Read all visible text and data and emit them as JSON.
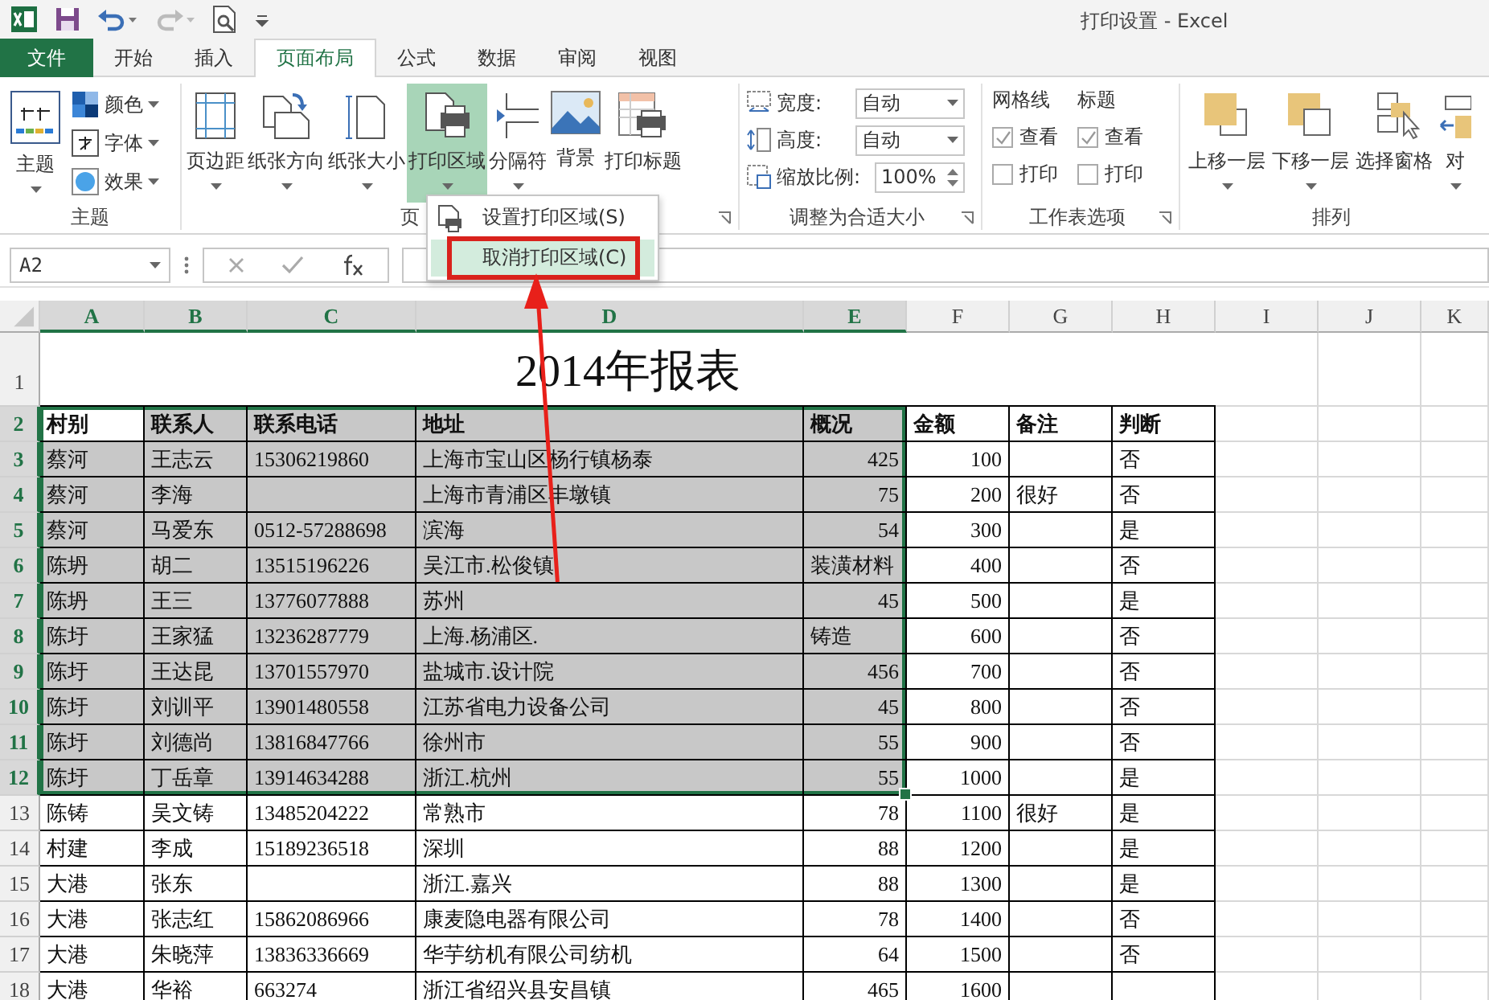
{
  "window": {
    "title": "打印设置 - Excel"
  },
  "tabs": [
    {
      "label": "文件",
      "kind": "file",
      "selected": false
    },
    {
      "label": "开始",
      "kind": "tab",
      "selected": false
    },
    {
      "label": "插入",
      "kind": "tab",
      "selected": false
    },
    {
      "label": "页面布局",
      "kind": "tab",
      "selected": true
    },
    {
      "label": "公式",
      "kind": "tab",
      "selected": false
    },
    {
      "label": "数据",
      "kind": "tab",
      "selected": false
    },
    {
      "label": "审阅",
      "kind": "tab",
      "selected": false
    },
    {
      "label": "视图",
      "kind": "tab",
      "selected": false
    }
  ],
  "ribbon": {
    "themes": {
      "label": "主题",
      "button": "主题",
      "options": [
        "颜色",
        "字体",
        "效果"
      ]
    },
    "page_setup": {
      "label": "页",
      "buttons": [
        {
          "label": "页边距",
          "dropdown": true,
          "selected": false
        },
        {
          "label": "纸张方向",
          "dropdown": true,
          "selected": false
        },
        {
          "label": "纸张大小",
          "dropdown": true,
          "selected": false
        },
        {
          "label": "打印区域",
          "dropdown": true,
          "selected": true
        },
        {
          "label": "分隔符",
          "dropdown": true,
          "selected": false
        },
        {
          "label": "背景",
          "dropdown": false,
          "selected": false
        },
        {
          "label": "打印标题",
          "dropdown": false,
          "selected": false
        }
      ]
    },
    "scale_to_fit": {
      "label": "调整为合适大小",
      "fields": [
        {
          "label": "宽度:",
          "value": "自动",
          "kind": "select"
        },
        {
          "label": "高度:",
          "value": "自动",
          "kind": "select"
        },
        {
          "label": "缩放比例:",
          "value": "100%",
          "kind": "spin"
        }
      ]
    },
    "sheet_options": {
      "label": "工作表选项",
      "columns": [
        {
          "heading": "网格线",
          "view": {
            "label": "查看",
            "checked": true
          },
          "print": {
            "label": "打印",
            "checked": false
          }
        },
        {
          "heading": "标题",
          "view": {
            "label": "查看",
            "checked": true
          },
          "print": {
            "label": "打印",
            "checked": false
          }
        }
      ]
    },
    "arrange": {
      "label": "排列",
      "buttons": [
        {
          "label": "上移一层",
          "dropdown": true
        },
        {
          "label": "下移一层",
          "dropdown": true
        },
        {
          "label": "选择窗格",
          "dropdown": false
        },
        {
          "label": "对",
          "dropdown": true
        }
      ]
    }
  },
  "print_area_menu": {
    "items": [
      {
        "label": "设置打印区域(S)",
        "selected": false
      },
      {
        "label": "取消打印区域(C)",
        "selected": true
      }
    ]
  },
  "formula_bar": {
    "name_box": "A2"
  },
  "sheet": {
    "columns": [
      {
        "letter": "A",
        "selected": true
      },
      {
        "letter": "B",
        "selected": true
      },
      {
        "letter": "C",
        "selected": true
      },
      {
        "letter": "D",
        "selected": true
      },
      {
        "letter": "E",
        "selected": true
      },
      {
        "letter": "F",
        "selected": false
      },
      {
        "letter": "G",
        "selected": false
      },
      {
        "letter": "H",
        "selected": false
      },
      {
        "letter": "I",
        "selected": false
      },
      {
        "letter": "J",
        "selected": false
      },
      {
        "letter": "K",
        "selected": false
      }
    ],
    "rows": [
      {
        "number": "1",
        "kind": "title",
        "selected": false,
        "title": "2014年报表"
      },
      {
        "number": "2",
        "kind": "header",
        "selected": true,
        "cells": [
          "村别",
          "联系人",
          "联系电话",
          "地址",
          "概况",
          "金额",
          "备注",
          "判断"
        ]
      },
      {
        "number": "3",
        "kind": "data",
        "selected": true,
        "cells": [
          "蔡河",
          "王志云",
          "15306219860",
          "上海市宝山区杨行镇杨泰",
          "425",
          "100",
          null,
          "否"
        ]
      },
      {
        "number": "4",
        "kind": "data",
        "selected": true,
        "cells": [
          "蔡河",
          "李海",
          null,
          "上海市青浦区丰墩镇",
          "75",
          "200",
          "很好",
          "否"
        ]
      },
      {
        "number": "5",
        "kind": "data",
        "selected": true,
        "cells": [
          "蔡河",
          "马爱东",
          "0512-57288698",
          "滨海",
          "54",
          "300",
          null,
          "是"
        ]
      },
      {
        "number": "6",
        "kind": "data",
        "selected": true,
        "cells": [
          "陈坍",
          "胡二",
          "13515196226",
          "吴江市.松俊镇",
          "装潢材料",
          "400",
          null,
          "否"
        ]
      },
      {
        "number": "7",
        "kind": "data",
        "selected": true,
        "cells": [
          "陈坍",
          "王三",
          "13776077888",
          "苏州",
          "45",
          "500",
          null,
          "是"
        ]
      },
      {
        "number": "8",
        "kind": "data",
        "selected": true,
        "cells": [
          "陈圩",
          "王家猛",
          "13236287779",
          "上海.杨浦区.",
          "铸造",
          "600",
          null,
          "否"
        ]
      },
      {
        "number": "9",
        "kind": "data",
        "selected": true,
        "cells": [
          "陈圩",
          "王达昆",
          "13701557970",
          "盐城市.设计院",
          "456",
          "700",
          null,
          "否"
        ]
      },
      {
        "number": "10",
        "kind": "data",
        "selected": true,
        "cells": [
          "陈圩",
          "刘训平",
          "13901480558",
          "江苏省电力设备公司",
          "45",
          "800",
          null,
          "否"
        ]
      },
      {
        "number": "11",
        "kind": "data",
        "selected": true,
        "cells": [
          "陈圩",
          "刘德尚",
          "13816847766",
          "徐州市",
          "55",
          "900",
          null,
          "否"
        ]
      },
      {
        "number": "12",
        "kind": "data",
        "selected": true,
        "cells": [
          "陈圩",
          "丁岳章",
          "13914634288",
          "浙江.杭州",
          "55",
          "1000",
          null,
          "是"
        ]
      },
      {
        "number": "13",
        "kind": "data",
        "selected": false,
        "cells": [
          "陈铸",
          "吴文铸",
          "13485204222",
          "常熟市",
          "78",
          "1100",
          "很好",
          "是"
        ]
      },
      {
        "number": "14",
        "kind": "data",
        "selected": false,
        "cells": [
          "村建",
          "李成",
          "15189236518",
          "深圳",
          "88",
          "1200",
          null,
          "是"
        ]
      },
      {
        "number": "15",
        "kind": "data",
        "selected": false,
        "cells": [
          "大港",
          "张东",
          null,
          "浙江.嘉兴",
          "88",
          "1300",
          null,
          "是"
        ]
      },
      {
        "number": "16",
        "kind": "data",
        "selected": false,
        "cells": [
          "大港",
          "张志红",
          "15862086966",
          "康麦隐电器有限公司",
          "78",
          "1400",
          null,
          "否"
        ]
      },
      {
        "number": "17",
        "kind": "data",
        "selected": false,
        "cells": [
          "大港",
          "朱晓萍",
          "13836336669",
          "华芋纺机有限公司纺机",
          "64",
          "1500",
          null,
          "否"
        ]
      },
      {
        "number": "18",
        "kind": "data",
        "selected": false,
        "cells": [
          "大港",
          "华裕",
          "663274",
          "浙江省绍兴县安昌镇",
          "465",
          "1600",
          null,
          null
        ]
      }
    ]
  }
}
